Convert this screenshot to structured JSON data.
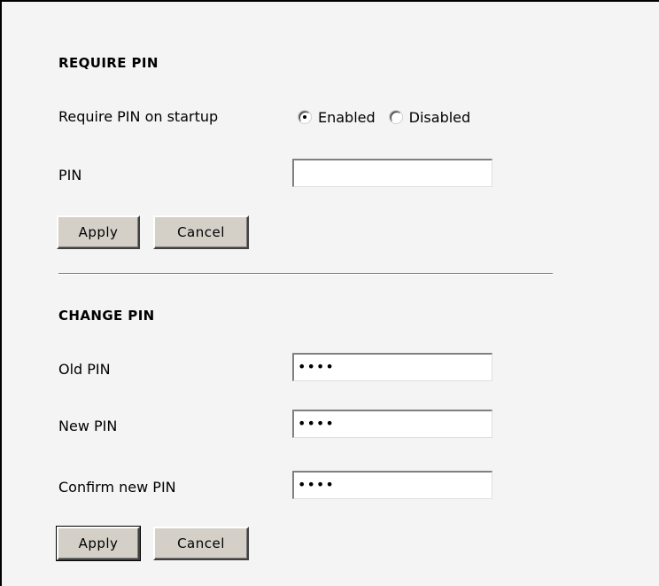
{
  "require_pin": {
    "title": "REQUIRE PIN",
    "startup_label": "Require PIN on startup",
    "options": [
      {
        "label": "Enabled",
        "selected": true
      },
      {
        "label": "Disabled",
        "selected": false
      }
    ],
    "pin_label": "PIN",
    "pin_value": "",
    "apply_label": "Apply",
    "cancel_label": "Cancel"
  },
  "change_pin": {
    "title": "CHANGE PIN",
    "old_label": "Old PIN",
    "old_value": "••••",
    "new_label": "New PIN",
    "new_value": "••••",
    "confirm_label": "Confirm new PIN",
    "confirm_value": "••••",
    "apply_label": "Apply",
    "cancel_label": "Cancel"
  }
}
